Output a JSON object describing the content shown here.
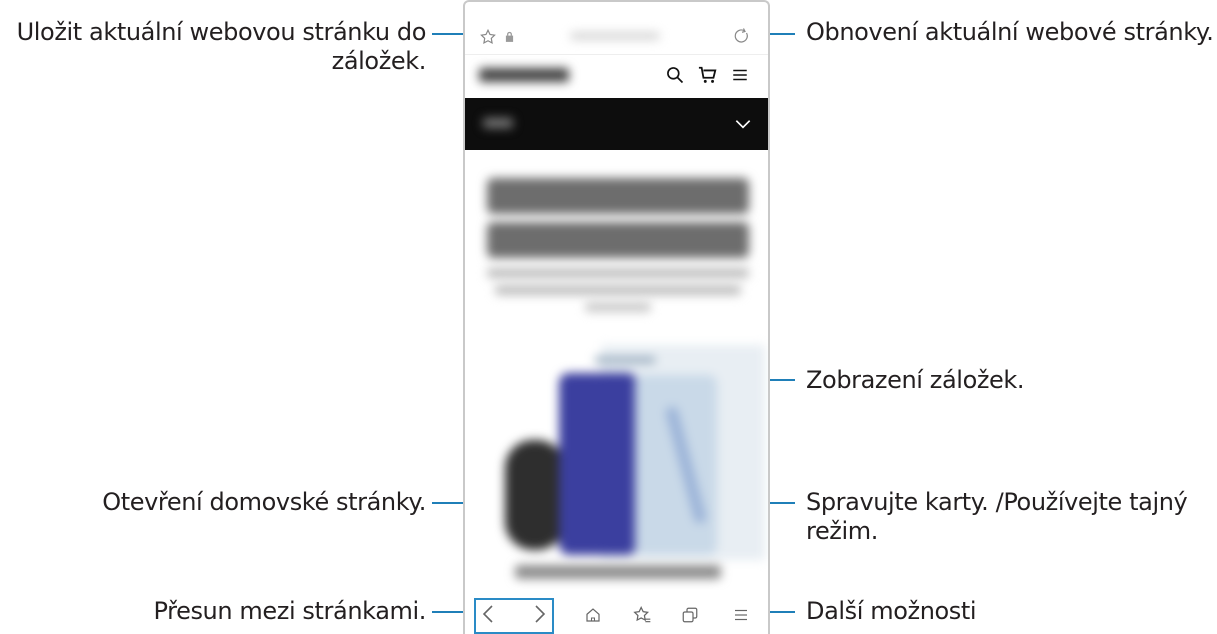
{
  "callouts": {
    "bookmark_add": "Uložit aktuální webovou stránku do",
    "bookmark_add_2": "záložek.",
    "refresh": "Obnovení aktuální webové stránky.",
    "bookmarks": "Zobrazení záložek.",
    "home": "Otevření domovské stránky.",
    "tabs": "Spravujte karty. /Používejte tajný",
    "tabs_2": "režim.",
    "navigate": "Přesun mezi stránkami.",
    "more": "Další možnosti"
  },
  "colors": {
    "callout_line": "#1f7fb8",
    "highlight_box": "#2a8bc6"
  },
  "icons": [
    "star-icon",
    "lock-icon",
    "refresh-icon",
    "search-icon",
    "cart-icon",
    "menu-icon",
    "chevron-down-icon",
    "back-icon",
    "forward-icon",
    "home-icon",
    "bookmarks-icon",
    "tabs-icon",
    "more-icon"
  ]
}
